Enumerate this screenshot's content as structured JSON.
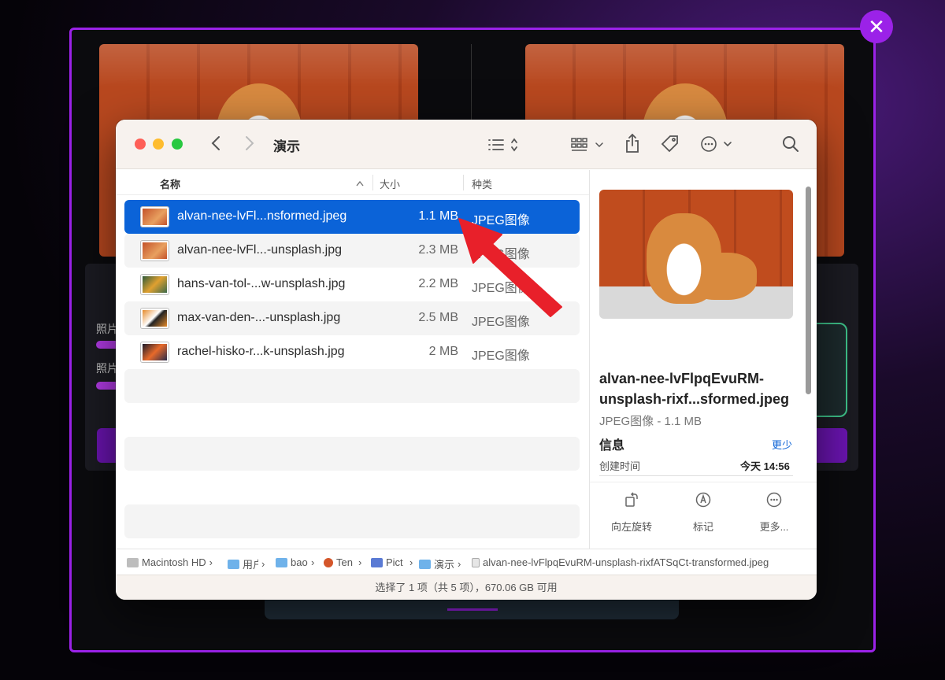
{
  "background_app": {
    "close_glyph": "✕",
    "label_a": "照片",
    "label_b": "照片"
  },
  "finder": {
    "title": "演示",
    "columns": {
      "name": "名称",
      "size": "大小",
      "kind": "种类"
    },
    "files": [
      {
        "name": "alvan-nee-lvFl...nsformed.jpeg",
        "size": "1.1 MB",
        "kind": "JPEG图像",
        "selected": true
      },
      {
        "name": "alvan-nee-lvFl...-unsplash.jpg",
        "size": "2.3 MB",
        "kind": "JPEG图像",
        "selected": false
      },
      {
        "name": "hans-van-tol-...w-unsplash.jpg",
        "size": "2.2 MB",
        "kind": "JPEG图像",
        "selected": false
      },
      {
        "name": "max-van-den-...-unsplash.jpg",
        "size": "2.5 MB",
        "kind": "JPEG图像",
        "selected": false
      },
      {
        "name": "rachel-hisko-r...k-unsplash.jpg",
        "size": "2 MB",
        "kind": "JPEG图像",
        "selected": false
      }
    ],
    "preview": {
      "filename": "alvan-nee-lvFlpqEvuRM-unsplash-rixf...sformed.jpeg",
      "kind_size": "JPEG图像 - 1.1 MB",
      "info_title": "信息",
      "less_link": "更少",
      "created_label": "创建时间",
      "created_value": "今天 14:56"
    },
    "quick_actions": [
      {
        "label": "向左旋转",
        "icon": "rotate-left-icon"
      },
      {
        "label": "标记",
        "icon": "markup-icon"
      },
      {
        "label": "更多...",
        "icon": "more-icon"
      }
    ],
    "path": [
      {
        "label": "Macintosh HD",
        "icon": "disk-icon"
      },
      {
        "label": "用户",
        "icon": "folder-icon"
      },
      {
        "label": "bao",
        "icon": "folder-icon"
      },
      {
        "label": "Ten",
        "icon": "user-folder-icon"
      },
      {
        "label": "Pict",
        "icon": "pictures-icon"
      },
      {
        "label": "演示",
        "icon": "folder-icon"
      },
      {
        "label": "alvan-nee-lvFlpqEvuRM-unsplash-rixfATSqCt-transformed.jpeg",
        "icon": "file-icon"
      }
    ],
    "status": "选择了 1 项（共 5 项），670.06 GB 可用"
  },
  "colors": {
    "selection": "#0b63d8",
    "accent_purple": "#9b22e8",
    "arrow_red": "#e8202a"
  }
}
